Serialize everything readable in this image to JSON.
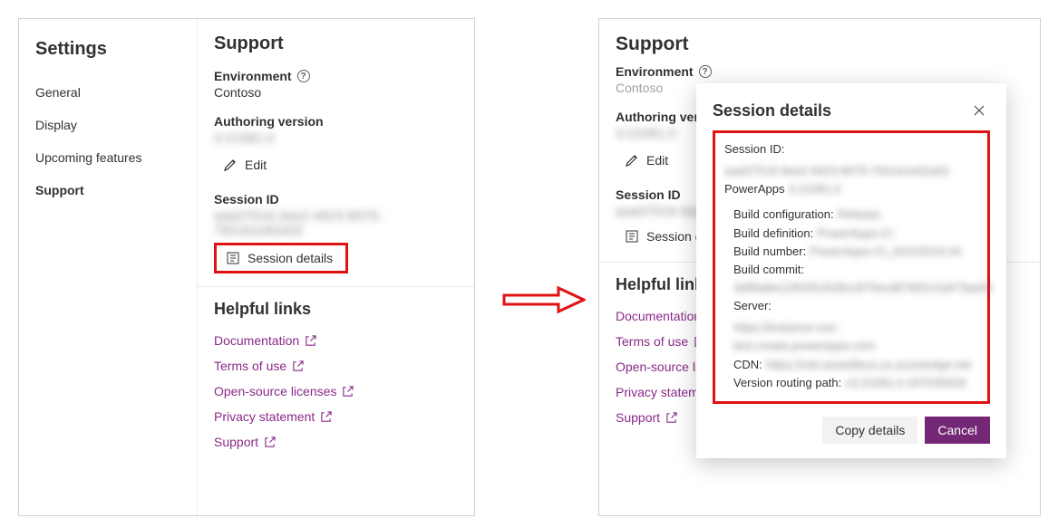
{
  "sidebar": {
    "title": "Settings",
    "items": [
      {
        "label": "General"
      },
      {
        "label": "Display"
      },
      {
        "label": "Upcoming features"
      },
      {
        "label": "Support",
        "selected": true
      }
    ]
  },
  "support": {
    "title": "Support",
    "env_label": "Environment",
    "env_value": "Contoso",
    "auth_label": "Authoring version",
    "auth_value_masked": "3.21081.0",
    "edit_label": "Edit",
    "session_label": "Session ID",
    "session_value_masked": "aaa07519-3ee2-4923-8075-792cb1e62a02",
    "session_details_btn": "Session details"
  },
  "links": {
    "title": "Helpful links",
    "items": [
      {
        "label": "Documentation"
      },
      {
        "label": "Terms of use"
      },
      {
        "label": "Open-source licenses"
      },
      {
        "label": "Privacy statement"
      },
      {
        "label": "Support"
      }
    ]
  },
  "right": {
    "title": "Support",
    "env_label": "Environment",
    "env_value": "Contoso",
    "auth_label_truncated": "Authoring vers",
    "auth_value_masked": "3.21081.0",
    "edit_label": "Edit",
    "session_label": "Session ID",
    "session_value_masked": "aaa07519-3ee2",
    "session_details_truncated": "Session de",
    "links_title_truncated": "Helpful link",
    "links": [
      {
        "label": "Documentation"
      },
      {
        "label": "Terms of use"
      },
      {
        "label": "Open-source lic"
      },
      {
        "label": "Privacy statement"
      },
      {
        "label": "Support"
      }
    ]
  },
  "dialog": {
    "title": "Session details",
    "rows": {
      "session_id_k": "Session ID:",
      "session_id_v": "aaa07519-3ee2-4923-8075-792cb1e62a02",
      "powerapps_k": "PowerApps",
      "powerapps_v": "3.21081.0",
      "build_conf_k": "Build configuration:",
      "build_conf_v": "Release",
      "build_def_k": "Build definition:",
      "build_def_v": "PowerApps-CI",
      "build_num_k": "Build number:",
      "build_num_v": "PowerApps-CI_20210524.04",
      "build_commit_k": "Build commit:",
      "build_commit_v": "3d89a8e1293351628cc870ecd87682c2a973aa05",
      "server_k": "Server:",
      "server_v": "https://instance-cus-test.create.powerapps.com",
      "cdn_k": "CDN:",
      "cdn_v": "https://cdn-powelleus.us.azureedge.net",
      "vroute_k": "Version routing path:",
      "vroute_v": "v3.21081.0.187035818"
    },
    "copy_btn": "Copy details",
    "cancel_btn": "Cancel"
  }
}
